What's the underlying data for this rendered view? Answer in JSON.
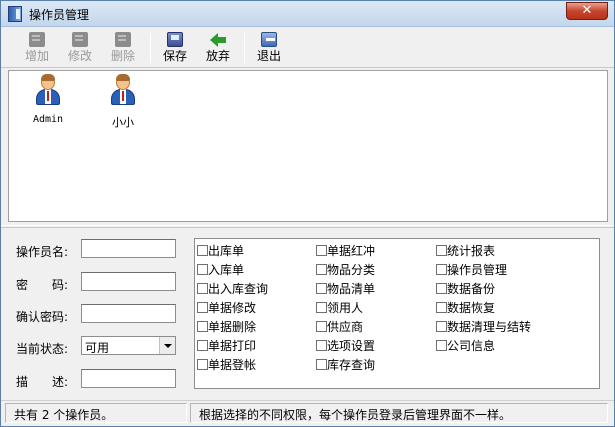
{
  "window": {
    "title": "操作员管理",
    "close_label": "✕"
  },
  "toolbar": {
    "add_label": "增加",
    "edit_label": "修改",
    "delete_label": "删除",
    "save_label": "保存",
    "discard_label": "放弃",
    "exit_label": "退出"
  },
  "users": [
    {
      "name": "Admin"
    },
    {
      "name": "小小"
    }
  ],
  "form": {
    "username_label": "操作员名:",
    "password_label": "密　　码:",
    "confirm_label": "确认密码:",
    "status_label": "当前状态:",
    "status_value": "可用",
    "desc_label": "描　　述:"
  },
  "permissions": {
    "col1": [
      "出库单",
      "入库单",
      "出入库查询",
      "单据修改",
      "单据删除",
      "单据打印",
      "单据登帐"
    ],
    "col2": [
      "单据红冲",
      "物品分类",
      "物品清单",
      "领用人",
      "供应商",
      "选项设置",
      "库存查询"
    ],
    "col3": [
      "统计报表",
      "操作员管理",
      "数据备份",
      "数据恢复",
      "数据清理与结转",
      "公司信息"
    ]
  },
  "status": {
    "count": "共有 2 个操作员。",
    "hint": "根据选择的不同权限，每个操作员登录后管理界面不一样。"
  },
  "colors": {
    "close_red": "#c7452e",
    "titlebar": "#c3d6ec"
  }
}
